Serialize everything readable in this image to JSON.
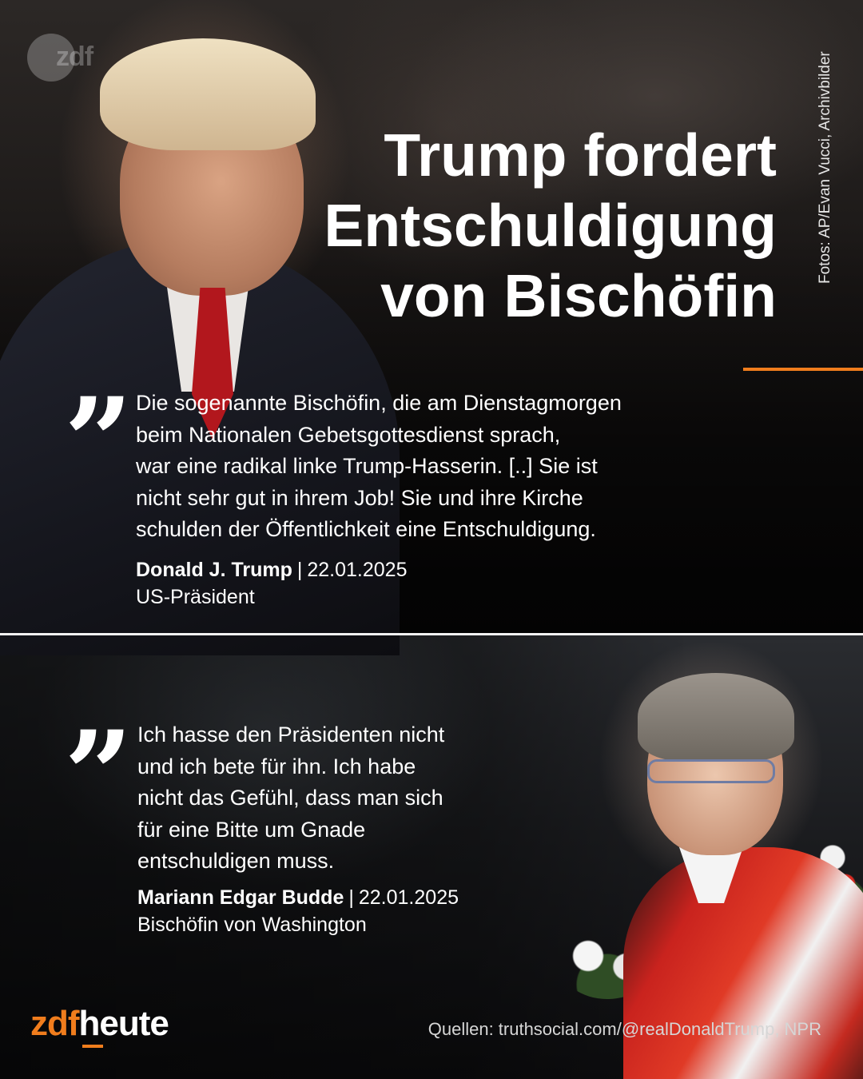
{
  "brand": {
    "watermark": "zdf",
    "logo_part1": "zdf",
    "logo_part2": "heute",
    "accent_color": "#f07d1d"
  },
  "photo_credit": "Fotos: AP/Evan Vucci, Archivbilder",
  "headline": {
    "line1": "Trump fordert",
    "line2": "Entschuldigung",
    "line3": "von Bischöfin"
  },
  "quotes": [
    {
      "mark": "”",
      "lines": [
        "Die sogenannte Bischöfin, die am Dienstagmorgen",
        "beim Nationalen Gebetsgottesdienst sprach,",
        "war eine radikal linke Trump-Hasserin. [..] Sie ist",
        "nicht sehr gut in ihrem Job! Sie und ihre Kirche",
        "schulden der Öffentlichkeit eine Entschuldigung."
      ],
      "author": "Donald J. Trump",
      "separator": "|",
      "date": "22.01.2025",
      "role": "US-Präsident"
    },
    {
      "mark": "”",
      "lines": [
        "Ich hasse den Präsidenten nicht",
        "und ich bete für ihn. Ich habe",
        "nicht das Gefühl, dass man sich",
        "für eine Bitte um Gnade",
        "entschuldigen muss."
      ],
      "author": "Mariann Edgar Budde",
      "separator": "|",
      "date": "22.01.2025",
      "role": "Bischöfin von Washington"
    }
  ],
  "sources": "Quellen: truthsocial.com/@realDonaldTrump, NPR"
}
